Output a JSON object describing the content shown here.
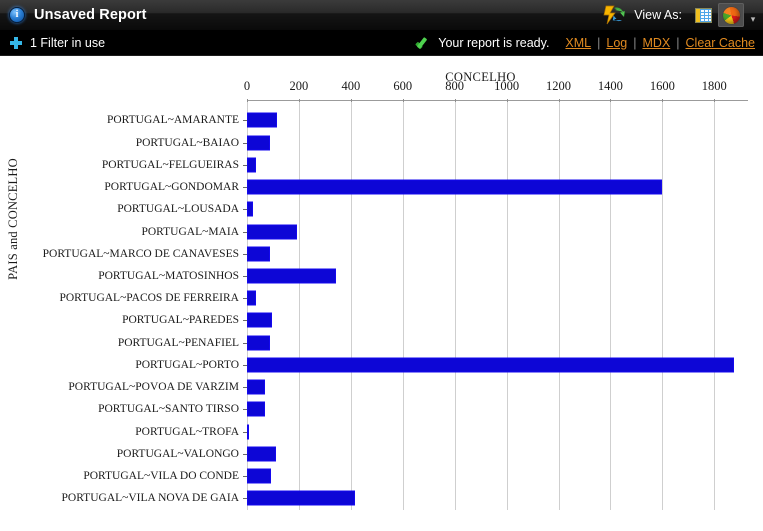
{
  "titlebar": {
    "info_icon": "info-icon",
    "title": "Unsaved Report",
    "refresh_icon": "lightning-refresh-icon",
    "view_as_label": "View As:",
    "grid_view_icon": "table-grid-icon",
    "chart_view_icon": "pie-chart-icon",
    "dropdown_icon": "chevron-down-icon",
    "selected_view": "chart"
  },
  "statusbar": {
    "plus_icon": "plus-icon",
    "filter_text": "1 Filter in use",
    "check_icon": "green-check-icon",
    "ready_text": "Your report is ready.",
    "links": [
      "XML",
      "Log",
      "MDX",
      "Clear Cache"
    ],
    "separator": "|",
    "link_color": "#e08a20"
  },
  "chart_data": {
    "type": "bar",
    "orientation": "horizontal",
    "title": "CONCELHO",
    "xlabel": "CONCELHO",
    "ylabel": "PAIS and CONCELHO",
    "xlim": [
      0,
      1930
    ],
    "xticks": [
      0,
      200,
      400,
      600,
      800,
      1000,
      1200,
      1400,
      1600,
      1800
    ],
    "grid": "vertical",
    "legend": "none",
    "bar_color": "#0d06d6",
    "categories": [
      "PORTUGAL~AMARANTE",
      "PORTUGAL~BAIAO",
      "PORTUGAL~FELGUEIRAS",
      "PORTUGAL~GONDOMAR",
      "PORTUGAL~LOUSADA",
      "PORTUGAL~MAIA",
      "PORTUGAL~MARCO DE CANAVESES",
      "PORTUGAL~MATOSINHOS",
      "PORTUGAL~PACOS DE FERREIRA",
      "PORTUGAL~PAREDES",
      "PORTUGAL~PENAFIEL",
      "PORTUGAL~PORTO",
      "PORTUGAL~POVOA DE VARZIM",
      "PORTUGAL~SANTO TIRSO",
      "PORTUGAL~TROFA",
      "PORTUGAL~VALONGO",
      "PORTUGAL~VILA DO CONDE",
      "PORTUGAL~VILA NOVA DE GAIA"
    ],
    "values": [
      115,
      90,
      35,
      1600,
      25,
      193,
      90,
      343,
      35,
      97,
      90,
      1875,
      70,
      70,
      8,
      112,
      93,
      417
    ]
  }
}
